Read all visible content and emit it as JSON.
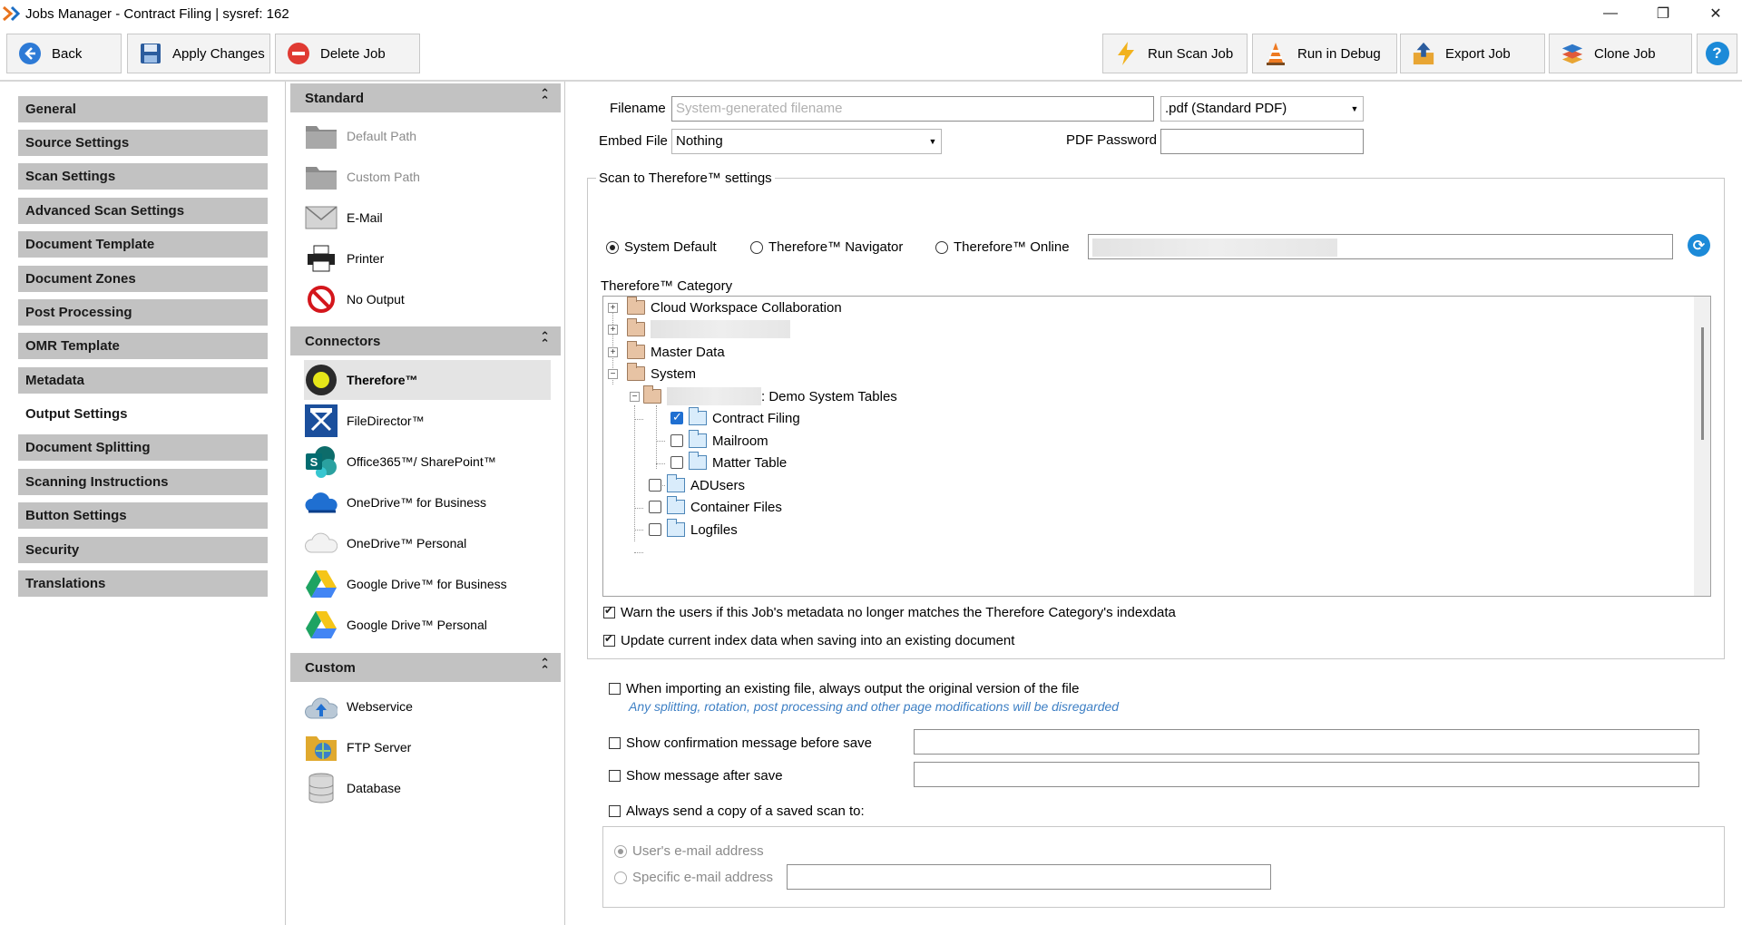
{
  "window": {
    "title": "Jobs Manager - Contract Filing  |  sysref: 162",
    "minimize_glyph": "—",
    "restore_glyph": "❐",
    "close_glyph": "✕"
  },
  "toolbar": {
    "back_label": "Back",
    "apply_label": "Apply Changes",
    "delete_label": "Delete Job",
    "run_scan_label": "Run Scan Job",
    "run_debug_label": "Run in Debug",
    "export_label": "Export Job",
    "clone_label": "Clone Job",
    "help_glyph": "?"
  },
  "leftnav": {
    "items": [
      {
        "label": "General"
      },
      {
        "label": "Source Settings"
      },
      {
        "label": "Scan Settings"
      },
      {
        "label": "Advanced Scan Settings"
      },
      {
        "label": "Document Template"
      },
      {
        "label": "Document Zones"
      },
      {
        "label": "Post Processing"
      },
      {
        "label": "OMR Template"
      },
      {
        "label": "Metadata"
      },
      {
        "label": "Output Settings"
      },
      {
        "label": "Document Splitting"
      },
      {
        "label": "Scanning Instructions"
      },
      {
        "label": "Button Settings"
      },
      {
        "label": "Security"
      },
      {
        "label": "Translations"
      }
    ],
    "active": "Output Settings"
  },
  "midpanel": {
    "standard_title": "Standard",
    "connectors_title": "Connectors",
    "custom_title": "Custom",
    "collapse_glyph": "⌃",
    "standard_items": [
      {
        "label": "Default Path",
        "icon": "folder-icon"
      },
      {
        "label": "Custom Path",
        "icon": "folder-icon"
      },
      {
        "label": "E-Mail",
        "icon": "envelope-icon"
      },
      {
        "label": "Printer",
        "icon": "printer-icon"
      },
      {
        "label": "No Output",
        "icon": "no-entry-icon"
      }
    ],
    "connector_items": [
      {
        "label": "Therefore™",
        "icon": "therefore-icon"
      },
      {
        "label": "FileDirector™",
        "icon": "filedirector-icon"
      },
      {
        "label": "Office365™/ SharePoint™",
        "icon": "sharepoint-icon"
      },
      {
        "label": "OneDrive™ for Business",
        "icon": "onedrive-business-icon"
      },
      {
        "label": "OneDrive™ Personal",
        "icon": "onedrive-personal-icon"
      },
      {
        "label": "Google Drive™ for Business",
        "icon": "google-drive-icon"
      },
      {
        "label": "Google Drive™ Personal",
        "icon": "google-drive-icon"
      }
    ],
    "custom_items": [
      {
        "label": "Webservice",
        "icon": "cloud-upload-icon"
      },
      {
        "label": "FTP Server",
        "icon": "ftp-folder-icon"
      },
      {
        "label": "Database",
        "icon": "database-icon"
      }
    ]
  },
  "output": {
    "filename_label": "Filename",
    "filename_placeholder": "System-generated filename",
    "format_value": ".pdf (Standard PDF)",
    "embed_label": "Embed File",
    "embed_value": "Nothing",
    "pdf_password_label": "PDF Password",
    "scan_group_title": "Scan to Therefore™ settings",
    "radio_system_default": "System Default",
    "radio_navigator": "Therefore™ Navigator",
    "radio_online": "Therefore™ Online",
    "category_label": "Therefore™ Category",
    "tree": {
      "cloud_workspace": "Cloud Workspace Collaboration",
      "master_data": "Master Data",
      "system": "System",
      "demo_tables": ": Demo System Tables",
      "contract_filing": "Contract Filing",
      "mailroom": "Mailroom",
      "matter_table": "Matter Table",
      "adusers": "ADUsers",
      "container_files": "Container Files",
      "logfiles": "Logfiles"
    },
    "warn_label": "Warn the users if this Job's metadata no longer matches the Therefore Category's indexdata",
    "update_label": "Update current index data when saving into an existing document",
    "original_version_label": "When importing an existing file, always output the original version of the file",
    "original_version_hint": "Any splitting, rotation, post processing and other page modifications will be disregarded",
    "confirm_label": "Show confirmation message before save",
    "after_save_label": "Show message after save",
    "copy_label": "Always send a copy of a saved scan to:",
    "user_email_label": "User's e-mail address",
    "specific_email_label": "Specific e-mail address",
    "refresh_glyph": "⟳"
  }
}
